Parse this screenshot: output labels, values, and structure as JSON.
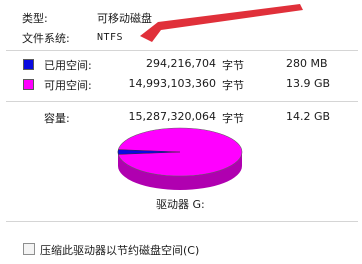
{
  "general": {
    "type_label": "类型:",
    "type_value": "可移动磁盘",
    "fs_label": "文件系统:",
    "fs_value": "NTFS"
  },
  "space": {
    "used": {
      "label": "已用空间:",
      "bytes": "294,216,704",
      "unit": "字节",
      "size": "280 MB",
      "color": "#0a0ae0",
      "fraction": 0.0196
    },
    "free": {
      "label": "可用空间:",
      "bytes": "14,993,103,360",
      "unit": "字节",
      "size": "13.9 GB",
      "color": "#ff00ff",
      "fraction": 0.9804
    },
    "capacity": {
      "label": "容量:",
      "bytes": "15,287,320,064",
      "unit": "字节",
      "size": "14.2 GB"
    }
  },
  "drive_label": "驱动器 G:",
  "compress_label": "压缩此驱动器以节约磁盘空间(C)",
  "annotation_color": "#e0303a"
}
